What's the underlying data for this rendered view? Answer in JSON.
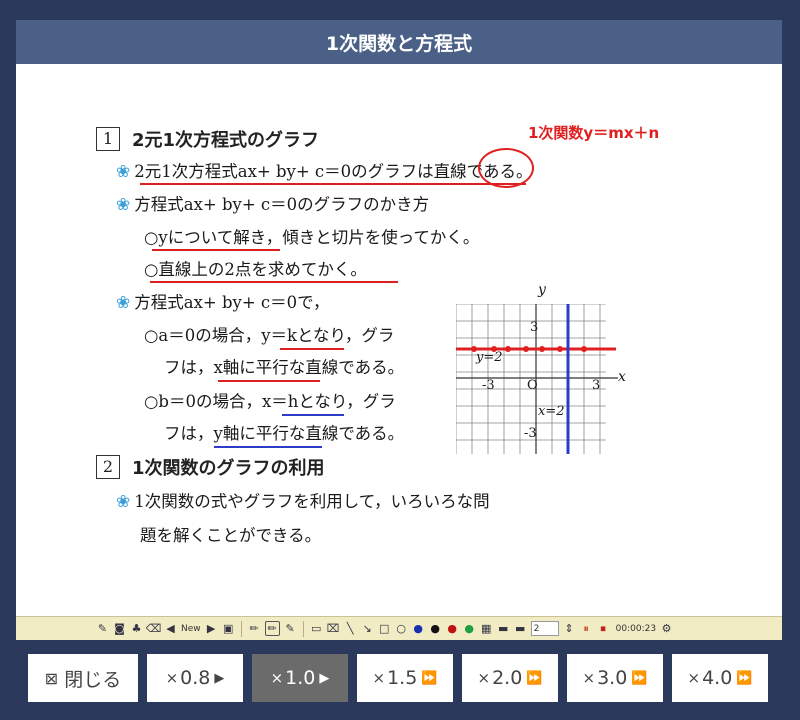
{
  "window": {
    "title": "1次関数と方程式"
  },
  "content": {
    "section1": {
      "num": "1",
      "heading": "2元1次方程式のグラフ"
    },
    "annotation": "1次関数y＝mx＋n",
    "lines": [
      "2元1次方程式ax+ by+ c＝0のグラフは直線である。",
      "方程式ax+ by+ c＝0のグラフのかき方",
      "○yについて解き，傾きと切片を使ってかく。",
      "○直線上の2点を求めてかく。",
      "方程式ax+ by+ c＝0で，",
      "○a＝0の場合，y＝kとなり，グラ",
      "フは，x軸に平行な直線である。",
      "○b＝0の場合，x＝hとなり，グラ",
      "フは，y軸に平行な直線である。"
    ],
    "section2": {
      "num": "2",
      "heading": "1次関数のグラフの利用"
    },
    "lines2": [
      "1次関数の式やグラフを利用して，いろいろな問",
      "題を解くことができる。"
    ],
    "graph": {
      "y_axis": "y",
      "x_axis": "x",
      "origin": "O",
      "tick_pos_x": "3",
      "tick_neg_x": "-3",
      "tick_pos_y": "3",
      "tick_neg_y": "-3",
      "label_y2": "y=2",
      "label_x2": "x=2"
    }
  },
  "toolbar": {
    "new_label": "New",
    "line_width": "2",
    "time": "00:00:23"
  },
  "buttons": [
    {
      "label": "閉じる",
      "icon": "close-box-icon"
    },
    {
      "x": "×",
      "label": "0.8",
      "arrow": "▶"
    },
    {
      "x": "×",
      "label": "1.0",
      "arrow": "▶"
    },
    {
      "x": "×",
      "label": "1.5",
      "arrow": "⏩"
    },
    {
      "x": "×",
      "label": "2.0",
      "arrow": "⏩"
    },
    {
      "x": "×",
      "label": "3.0",
      "arrow": "⏩"
    },
    {
      "x": "×",
      "label": "4.0",
      "arrow": "⏩"
    }
  ],
  "colors": {
    "accent_red": "#e02020",
    "accent_blue": "#2a3cc8",
    "title_bg": "#4a6087",
    "page_bg": "#2b3a5c"
  }
}
